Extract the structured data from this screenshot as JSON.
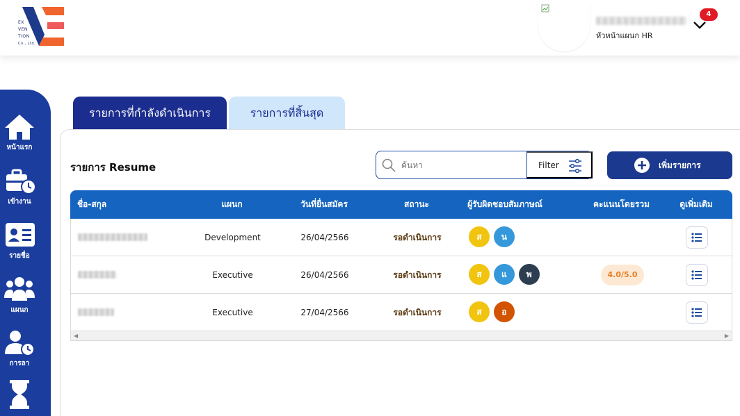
{
  "header": {
    "logo_text": [
      "EX",
      "VEN",
      "TION",
      "Co., Ltd."
    ],
    "user_role": "หัวหน้าแผนก HR",
    "notification_count": "4"
  },
  "sidebar": {
    "items": [
      {
        "label": "หน้าแรก",
        "icon": "home-icon"
      },
      {
        "label": "เข้างาน",
        "icon": "briefcase-clock-icon"
      },
      {
        "label": "รายชื่อ",
        "icon": "id-card-icon"
      },
      {
        "label": "แผนก",
        "icon": "users-icon"
      },
      {
        "label": "การลา",
        "icon": "user-clock-icon"
      },
      {
        "label": "",
        "icon": "hourglass-icon"
      }
    ]
  },
  "tabs": [
    {
      "label": "รายการที่กำลังดำเนินการ",
      "active": true
    },
    {
      "label": "รายการที่สิ้นสุด",
      "active": false
    }
  ],
  "main": {
    "title": "รายการ Resume",
    "search_placeholder": "ค้นหา",
    "filter_label": "Filter",
    "add_label": "เพิ่มรายการ"
  },
  "table": {
    "columns": [
      "ชื่อ-สกุล",
      "แผนก",
      "วันที่ยื่นสมัคร",
      "สถานะ",
      "ผู้รับผิดชอบสัมภาษณ์",
      "คะแนนโดยรวม",
      "ดูเพิ่มเติม"
    ],
    "rows": [
      {
        "department": "Development",
        "date": "26/04/2566",
        "status": "รอดำเนินการ",
        "interviewers": [
          {
            "letter": "ส",
            "color": "#f1c40f"
          },
          {
            "letter": "น",
            "color": "#3498db"
          }
        ],
        "score": ""
      },
      {
        "department": "Executive",
        "date": "26/04/2566",
        "status": "รอดำเนินการ",
        "interviewers": [
          {
            "letter": "ส",
            "color": "#f1c40f"
          },
          {
            "letter": "แ",
            "color": "#3498db"
          },
          {
            "letter": "พ",
            "color": "#2c3e50"
          }
        ],
        "score": "4.0/5.0"
      },
      {
        "department": "Executive",
        "date": "27/04/2566",
        "status": "รอดำเนินการ",
        "interviewers": [
          {
            "letter": "ส",
            "color": "#f1c40f"
          },
          {
            "letter": "อ",
            "color": "#d35400"
          }
        ],
        "score": ""
      }
    ]
  },
  "colors": {
    "primary": "#1b3a8f",
    "header_blue": "#1565c0",
    "tab_inactive": "#cfe6fb",
    "badge_red": "#e01b24",
    "score_orange": "#e67e22"
  }
}
